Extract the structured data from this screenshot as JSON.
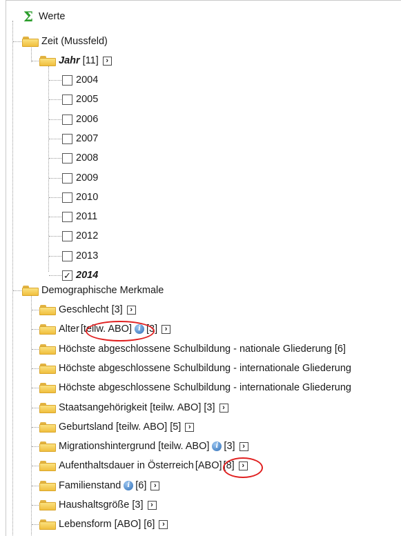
{
  "tree": {
    "root": {
      "label": "Werte"
    },
    "time_group": {
      "label": "Zeit (Mussfeld)"
    },
    "jahr": {
      "label": "Jahr",
      "count": "[11]"
    },
    "years": [
      {
        "label": "2004",
        "checked": false
      },
      {
        "label": "2005",
        "checked": false
      },
      {
        "label": "2006",
        "checked": false
      },
      {
        "label": "2007",
        "checked": false
      },
      {
        "label": "2008",
        "checked": false
      },
      {
        "label": "2009",
        "checked": false
      },
      {
        "label": "2010",
        "checked": false
      },
      {
        "label": "2011",
        "checked": false
      },
      {
        "label": "2012",
        "checked": false
      },
      {
        "label": "2013",
        "checked": false
      },
      {
        "label": "2014",
        "checked": true
      }
    ],
    "demo_group": {
      "label": "Demographische Merkmale"
    },
    "demo_items": [
      {
        "label": "Geschlecht [3]"
      },
      {
        "label": "Alter",
        "abo": "[teilw. ABO]",
        "count": "[3]"
      },
      {
        "label": "Höchste abgeschlossene Schulbildung - nationale Gliederung [6]"
      },
      {
        "label": "Höchste abgeschlossene Schulbildung - internationale Gliederung"
      },
      {
        "label": "Höchste abgeschlossene Schulbildung - internationale Gliederung"
      },
      {
        "label": "Staatsangehörigkeit [teilw. ABO] [3]"
      },
      {
        "label": "Geburtsland [teilw. ABO] [5]"
      },
      {
        "label": "Migrationshintergrund [teilw. ABO]",
        "count": "[3]"
      },
      {
        "label": "Aufenthaltsdauer in Österreich",
        "abo": "[ABO]",
        "count": "[8]"
      },
      {
        "label": "Familienstand",
        "count": "[6]"
      },
      {
        "label": "Haushaltsgröße [3]"
      },
      {
        "label": "Lebensform [ABO] [6]"
      }
    ],
    "check_mark": "✓",
    "chevron_glyph": "›",
    "info_glyph": "i",
    "sigma_glyph": "Σ"
  },
  "colors": {
    "highlight_circle": "#e02020",
    "sigma": "#2a9d2a",
    "folder": "#f0bf3e"
  }
}
